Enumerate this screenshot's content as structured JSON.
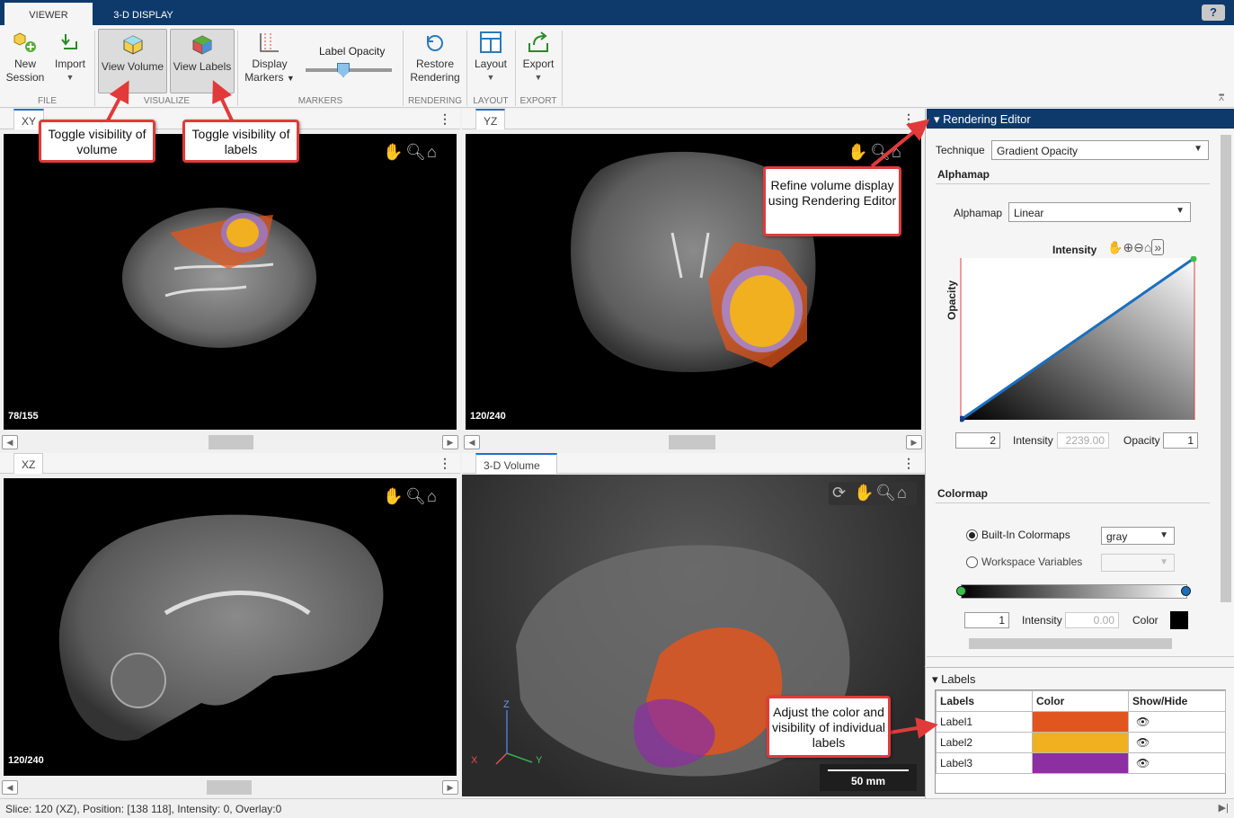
{
  "tabs": [
    {
      "label": "VIEWER"
    },
    {
      "label": "3-D DISPLAY"
    }
  ],
  "help_label": "?",
  "ribbon": {
    "new_session": "New Session",
    "import": "Import",
    "view_volume": "View Volume",
    "view_labels": "View Labels",
    "display_markers": "Display Markers",
    "label_opacity": "Label Opacity",
    "label_opacity_value": 0.3,
    "restore_rendering": "Restore Rendering",
    "layout": "Layout",
    "export": "Export",
    "groups": {
      "file": "FILE",
      "visualize": "VISUALIZE",
      "markers": "MARKERS",
      "rendering": "RENDERING",
      "layout": "LAYOUT",
      "export": "EXPORT"
    }
  },
  "panes": {
    "xy": {
      "tab": "XY",
      "slice": "78/155"
    },
    "yz": {
      "tab": "YZ",
      "slice": "120/240"
    },
    "xz": {
      "tab": "XZ",
      "slice": "120/240"
    },
    "vol": {
      "tab": "3-D Volume",
      "scale": "50 mm",
      "axis_x": "X",
      "axis_y": "Y",
      "axis_z": "Z"
    }
  },
  "callouts": {
    "volume": "Toggle visibility of volume",
    "labels": "Toggle visibility of labels",
    "editor": "Refine volume display using Rendering Editor",
    "color": "Adjust the color and visibility of individual labels"
  },
  "editor": {
    "title": "Rendering Editor",
    "technique_label": "Technique",
    "technique_value": "Gradient Opacity",
    "alphamap_section": "Alphamap",
    "alphamap_label": "Alphamap",
    "alphamap_value": "Linear",
    "plot_title": "Intensity",
    "plot_ylabel": "Opacity",
    "point_index": "2",
    "intensity_label": "Intensity",
    "intensity_value": "2239.00",
    "opacity_label": "Opacity",
    "opacity_value": "1",
    "colormap_section": "Colormap",
    "builtin_label": "Built-In Colormaps",
    "builtin_value": "gray",
    "workspace_label": "Workspace Variables",
    "cmap_index": "1",
    "cmap_intensity_label": "Intensity",
    "cmap_intensity_value": "0.00",
    "color_label": "Color"
  },
  "labels_panel": {
    "title": "Labels",
    "headers": [
      "Labels",
      "Color",
      "Show/Hide"
    ],
    "rows": [
      {
        "name": "Label1",
        "color": "#e0561e"
      },
      {
        "name": "Label2",
        "color": "#f0b020"
      },
      {
        "name": "Label3",
        "color": "#8c2fa0"
      }
    ]
  },
  "status": "Slice: 120 (XZ), Position: [138 118], Intensity: 0, Overlay:0"
}
